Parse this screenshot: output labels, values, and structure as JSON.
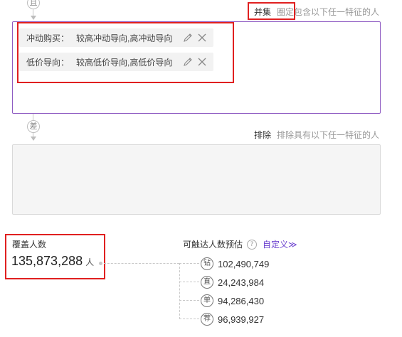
{
  "flow": {
    "top_op": "且",
    "mid_op": "差"
  },
  "union": {
    "title": "并集",
    "desc": "圈定包含以下任一特征的人",
    "tags": [
      {
        "key": "冲动购买：",
        "value": "较高冲动导向,高冲动导向"
      },
      {
        "key": "低价导向：",
        "value": "较高低价导向,高低价导向"
      }
    ]
  },
  "exclude": {
    "title": "排除",
    "desc": "排除具有以下任一特征的人"
  },
  "coverage": {
    "label": "覆盖人数",
    "value": "135,873,288",
    "unit": "人"
  },
  "reach": {
    "label": "可触达人数预估",
    "help": "?",
    "custom_link": "自定义≫",
    "channels": [
      {
        "icon": "钻",
        "value": "102,490,749"
      },
      {
        "icon": "直",
        "value": "24,243,984"
      },
      {
        "icon": "单",
        "value": "94,286,430"
      },
      {
        "icon": "荐",
        "value": "96,939,927"
      }
    ]
  },
  "colors": {
    "accent": "#8e5bc2",
    "link": "#6a3fcf",
    "highlight": "#e02020"
  }
}
